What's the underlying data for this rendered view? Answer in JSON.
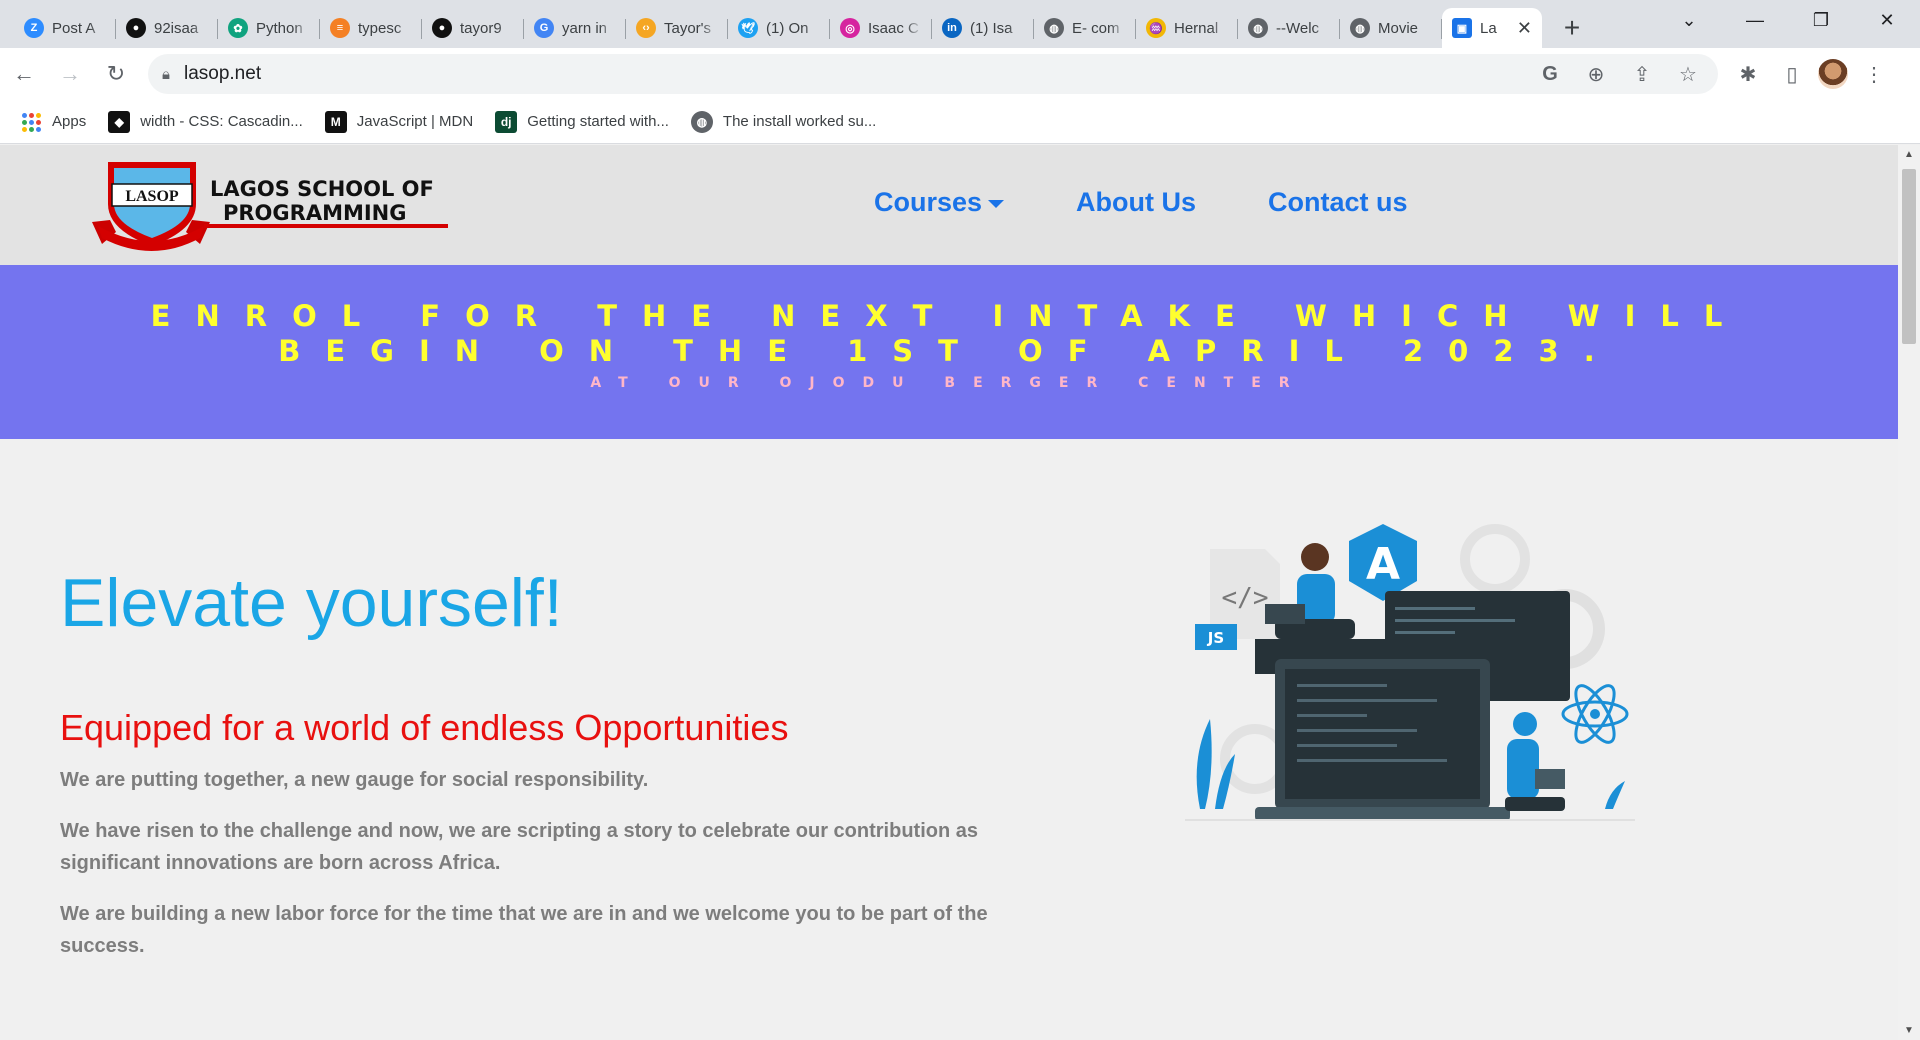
{
  "browser": {
    "tabs": [
      {
        "title": "Post A",
        "icon": "Z",
        "color": "#2d8cff"
      },
      {
        "title": "92isaa",
        "icon": "github",
        "color": "#111111"
      },
      {
        "title": "Python",
        "icon": "gpt",
        "color": "#10a37f"
      },
      {
        "title": "typesc",
        "icon": "so",
        "color": "#f48024"
      },
      {
        "title": "tayor9",
        "icon": "github",
        "color": "#111111"
      },
      {
        "title": "yarn in",
        "icon": "G",
        "color": "#4285f4"
      },
      {
        "title": "Tayor's",
        "icon": "code",
        "color": "#f5a623"
      },
      {
        "title": "(1) On",
        "icon": "twitter",
        "color": "#1da1f2"
      },
      {
        "title": "Isaac C",
        "icon": "ig",
        "color": "#d6249f"
      },
      {
        "title": "(1) Isa",
        "icon": "in",
        "color": "#0a66c2"
      },
      {
        "title": "E- com",
        "icon": "globe",
        "color": "#5f6368"
      },
      {
        "title": "Hernal",
        "icon": "wave",
        "color": "#f2b705"
      },
      {
        "title": "--Welc",
        "icon": "globe",
        "color": "#5f6368"
      },
      {
        "title": "Movie",
        "icon": "globe",
        "color": "#5f6368"
      }
    ],
    "active_tab": {
      "title": "La",
      "icon": "lasop",
      "color": "#1a73e8"
    },
    "new_tab_symbol": "+",
    "url": "lasop.net",
    "bookmarks": [
      {
        "label": "Apps",
        "icon": "apps-grid"
      },
      {
        "label": "width - CSS: Cascadin...",
        "icon": "mdn-old"
      },
      {
        "label": "JavaScript | MDN",
        "icon": "mdn"
      },
      {
        "label": "Getting started with...",
        "icon": "django"
      },
      {
        "label": "The install worked su...",
        "icon": "globe"
      }
    ]
  },
  "site": {
    "logo": {
      "badge": "LASOP",
      "line1": "LAGOS SCHOOL OF",
      "line2": "PROGRAMMING"
    },
    "nav": [
      {
        "label": "Courses",
        "dropdown": true
      },
      {
        "label": "About Us",
        "dropdown": false
      },
      {
        "label": "Contact us",
        "dropdown": false
      }
    ],
    "banner": {
      "headline": "Enrol for the next intake which will begin on the 1st of April 2023.",
      "sub": "At our Ojodu Berger Center"
    },
    "hero": {
      "title": "Elevate yourself!",
      "subtitle": "Equipped for a world of endless Opportunities",
      "paragraphs": [
        "We are putting together, a new gauge for social responsibility.",
        "We have risen to the challenge and now, we are scripting a story to celebrate our contribution as significant innovations are born across Africa.",
        "We are building a new labor force for the time that we are in and we welcome you to be part of the success."
      ],
      "illustration": {
        "code_badge": "</>",
        "js_badge": "JS",
        "angular_letter": "A"
      }
    }
  },
  "colors": {
    "banner_bg": "#7474ef",
    "banner_headline": "#ffff2e",
    "banner_sub": "#ffb6c8",
    "nav_link": "#1a73e8",
    "hero_title": "#1aa6e6",
    "hero_subtitle": "#e8100f",
    "body_text": "#7d7d7d"
  }
}
